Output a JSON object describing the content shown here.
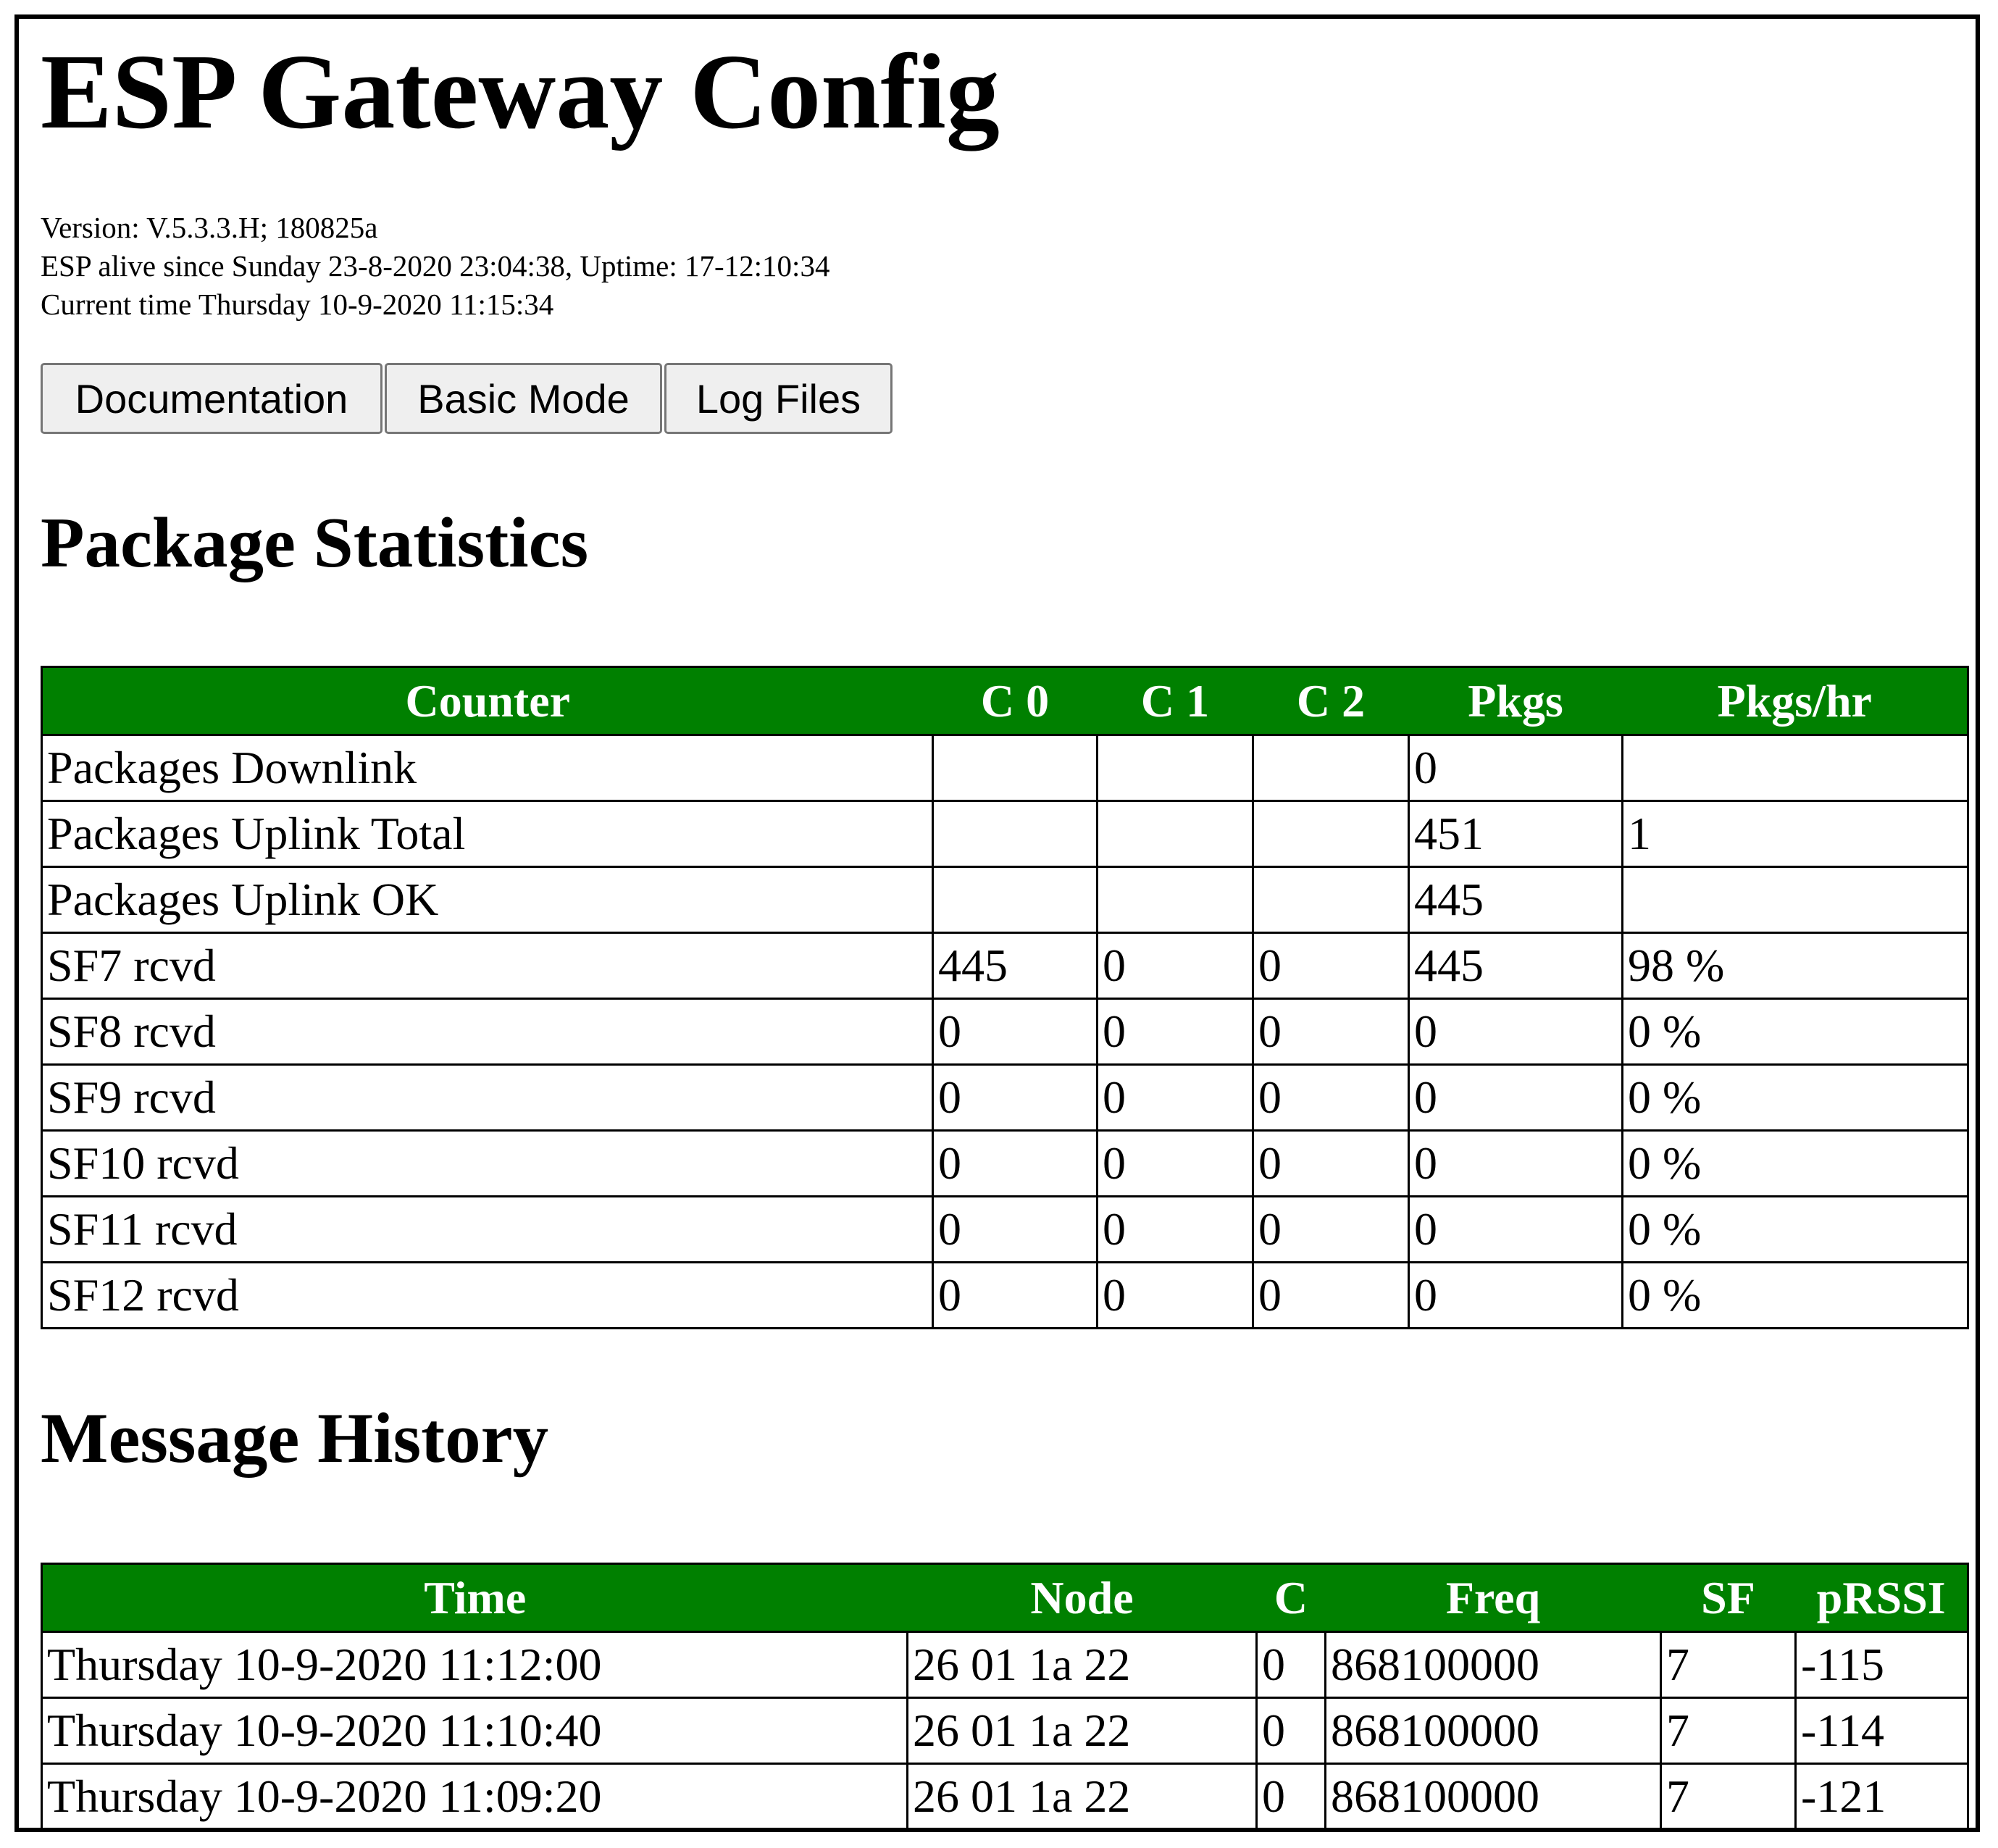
{
  "page": {
    "title": "ESP Gateway Config",
    "version_line": "Version: V.5.3.3.H; 180825a",
    "alive_line": "ESP alive since Sunday 23-8-2020 23:04:38, Uptime: 17-12:10:34",
    "current_time_line": "Current time Thursday 10-9-2020 11:15:34"
  },
  "buttons": {
    "documentation": "Documentation",
    "basic_mode": "Basic Mode",
    "log_files": "Log Files"
  },
  "package_statistics": {
    "title": "Package Statistics",
    "headers": [
      "Counter",
      "C 0",
      "C 1",
      "C 2",
      "Pkgs",
      "Pkgs/hr"
    ],
    "rows": [
      [
        "Packages Downlink",
        "",
        "",
        "",
        "0",
        ""
      ],
      [
        "Packages Uplink Total",
        "",
        "",
        "",
        "451",
        "1"
      ],
      [
        "Packages Uplink OK",
        "",
        "",
        "",
        "445",
        ""
      ],
      [
        "SF7 rcvd",
        "445",
        "0",
        "0",
        "445",
        "98 %"
      ],
      [
        "SF8 rcvd",
        "0",
        "0",
        "0",
        "0",
        "0 %"
      ],
      [
        "SF9 rcvd",
        "0",
        "0",
        "0",
        "0",
        "0 %"
      ],
      [
        "SF10 rcvd",
        "0",
        "0",
        "0",
        "0",
        "0 %"
      ],
      [
        "SF11 rcvd",
        "0",
        "0",
        "0",
        "0",
        "0 %"
      ],
      [
        "SF12 rcvd",
        "0",
        "0",
        "0",
        "0",
        "0 %"
      ]
    ]
  },
  "message_history": {
    "title": "Message History",
    "headers": [
      "Time",
      "Node",
      "C",
      "Freq",
      "SF",
      "pRSSI"
    ],
    "rows": [
      [
        "Thursday 10-9-2020 11:12:00",
        "26 01 1a 22",
        "0",
        "868100000",
        "7",
        "-115"
      ],
      [
        "Thursday 10-9-2020 11:10:40",
        "26 01 1a 22",
        "0",
        "868100000",
        "7",
        "-114"
      ],
      [
        "Thursday 10-9-2020 11:09:20",
        "26 01 1a 22",
        "0",
        "868100000",
        "7",
        "-121"
      ]
    ]
  },
  "colors": {
    "table_header_bg": "#008000",
    "table_header_text": "#ffffff",
    "button_bg": "#efefef"
  }
}
